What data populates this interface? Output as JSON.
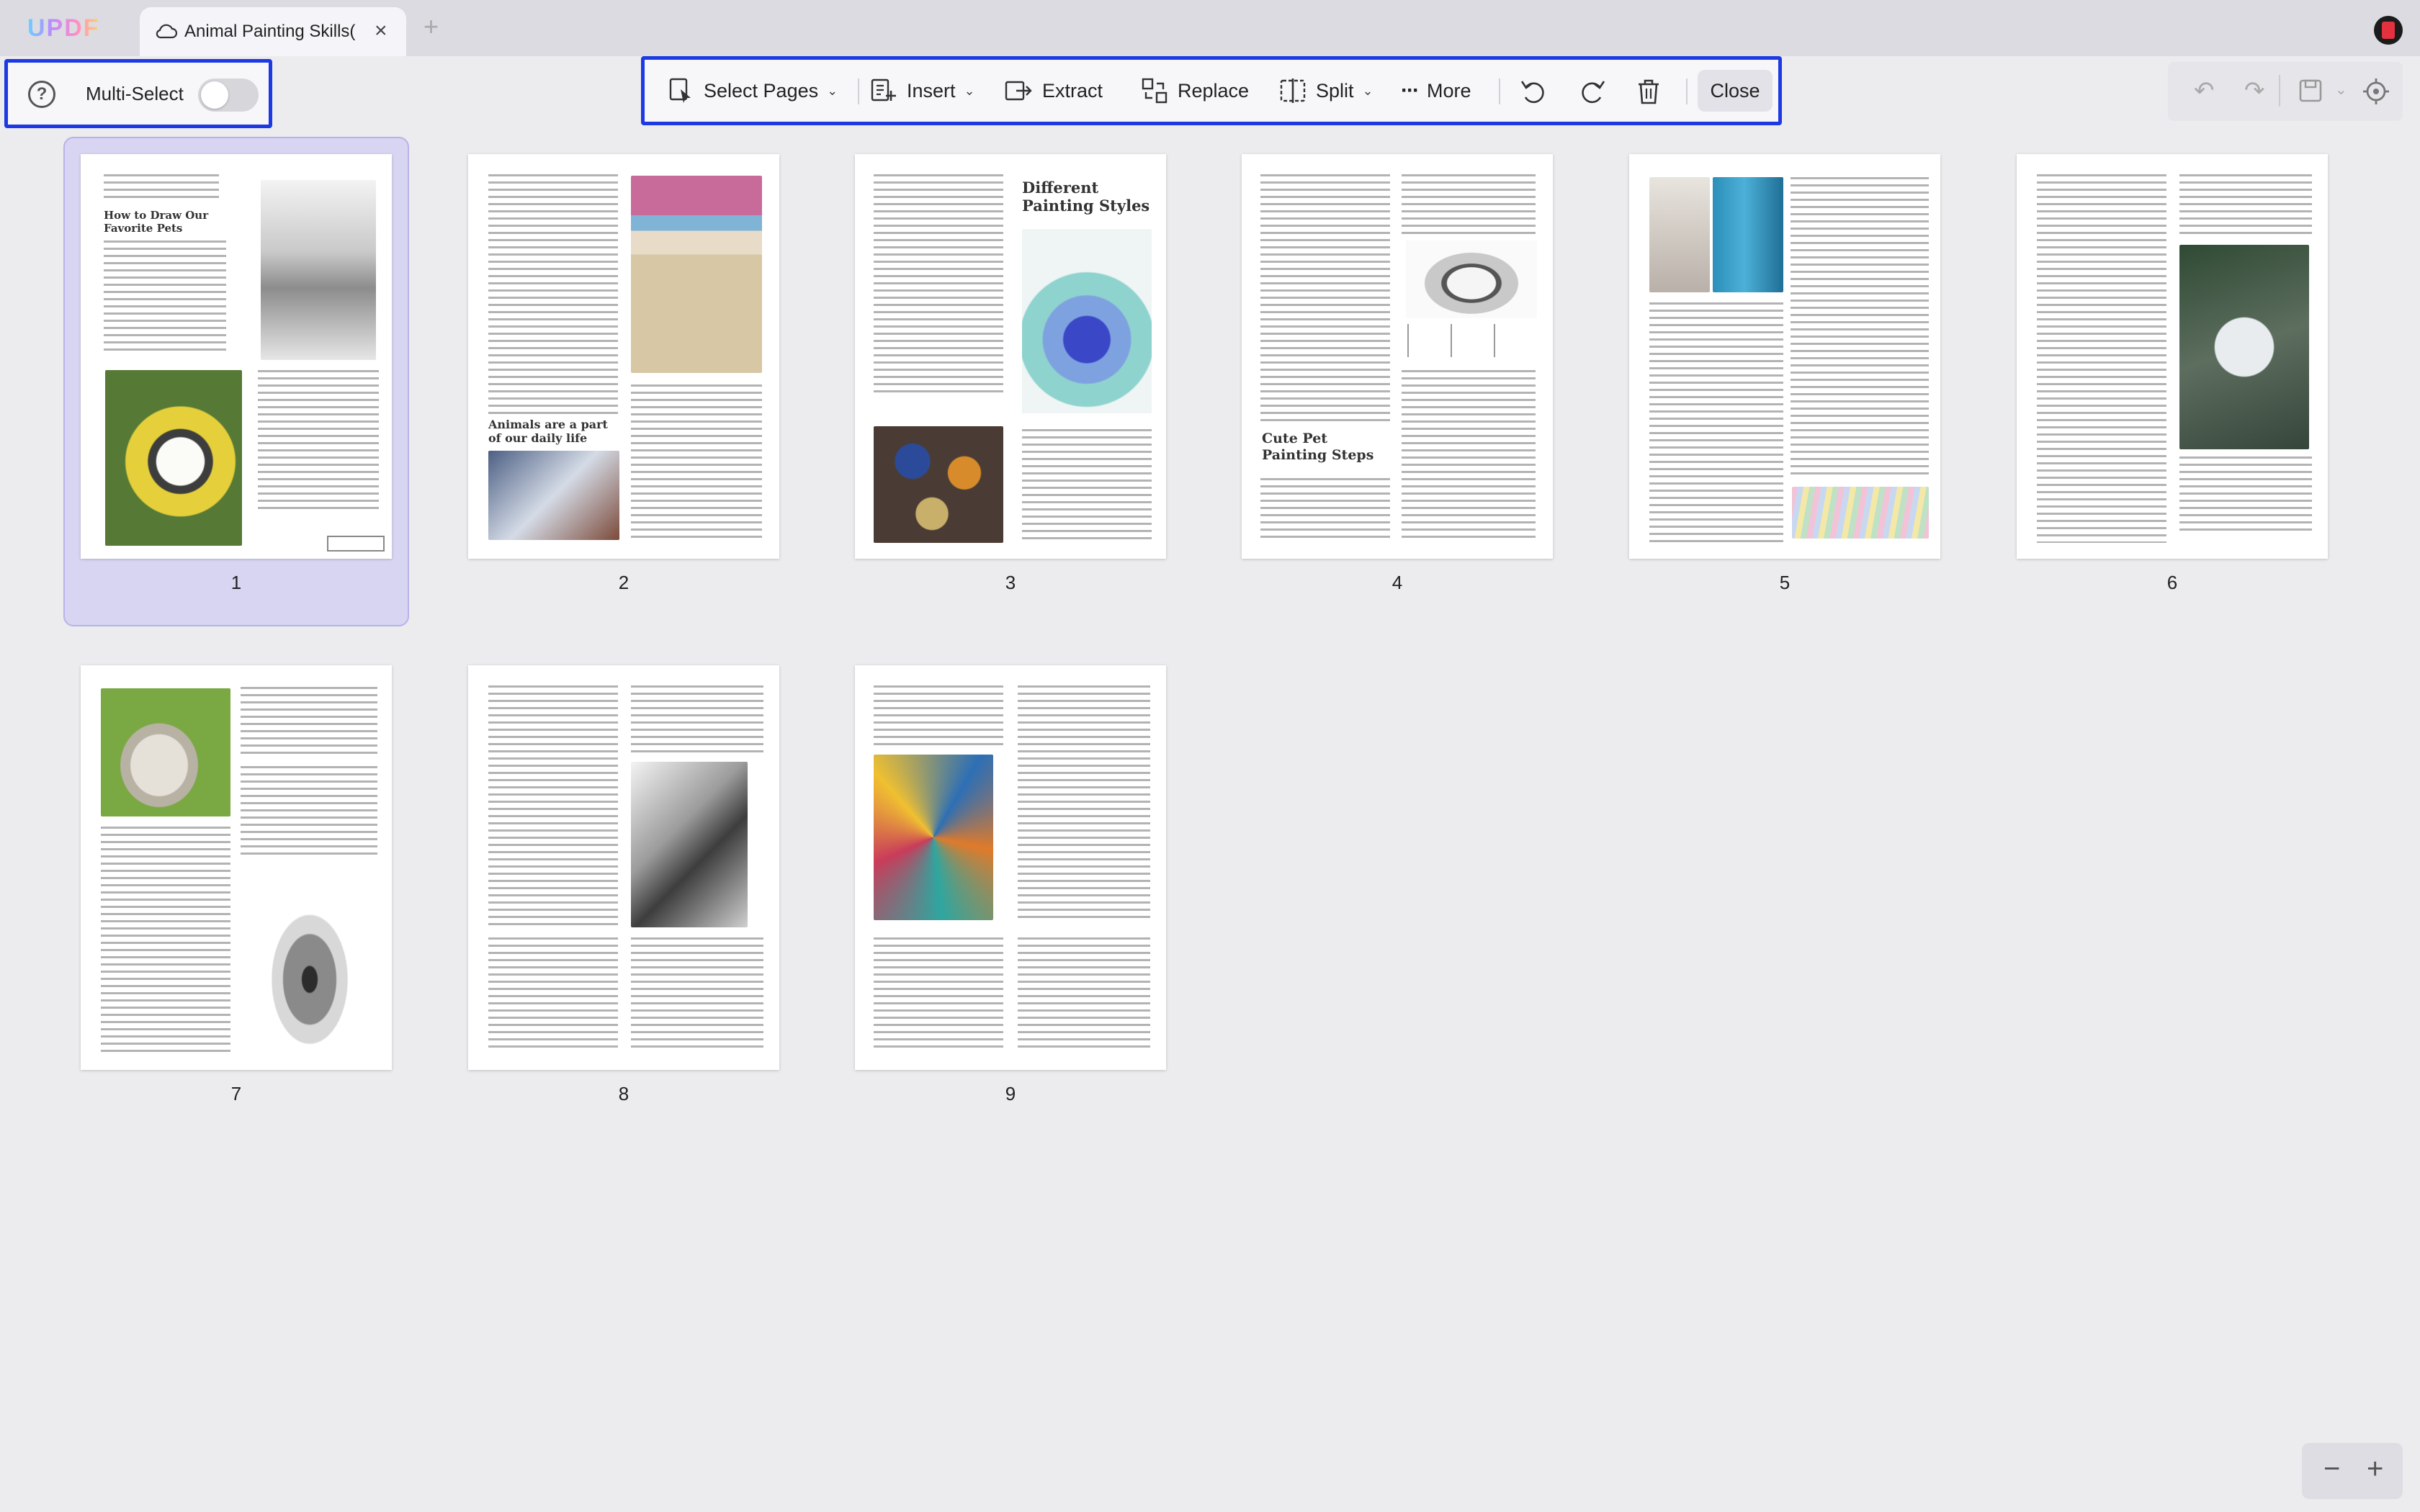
{
  "app": {
    "name": "UPDF"
  },
  "tab": {
    "title": "Animal Painting Skills(",
    "close": "×",
    "new": "+"
  },
  "multiselect": {
    "label": "Multi-Select",
    "help": "?"
  },
  "toolbar": {
    "select_pages": "Select Pages",
    "insert": "Insert",
    "extract": "Extract",
    "replace": "Replace",
    "split": "Split",
    "more": "More",
    "close": "Close",
    "chevron": "⌄"
  },
  "pages": {
    "p1": {
      "number": "1",
      "title": "How to Draw Our Favorite Pets"
    },
    "p2": {
      "number": "2",
      "title": "Animals are a part of our daily life"
    },
    "p3": {
      "number": "3",
      "title": "Different Painting Styles"
    },
    "p4": {
      "number": "4",
      "title": "Cute Pet Painting Steps"
    },
    "p5": {
      "number": "5"
    },
    "p6": {
      "number": "6"
    },
    "p7": {
      "number": "7"
    },
    "p8": {
      "number": "8"
    },
    "p9": {
      "number": "9"
    }
  },
  "zoom": {
    "minus": "−",
    "plus": "+"
  },
  "colors": {
    "highlight": "#1c39e3",
    "selection": "#d7d5f1"
  }
}
